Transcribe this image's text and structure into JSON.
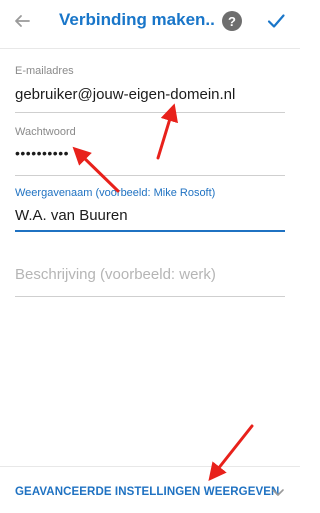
{
  "header": {
    "title": "Verbinding maken...",
    "help_symbol": "?",
    "back_icon": "arrow-left-icon",
    "confirm_icon": "checkmark-icon"
  },
  "form": {
    "email": {
      "label": "E-mailadres",
      "value": "gebruiker@jouw-eigen-domein.nl"
    },
    "password": {
      "label": "Wachtwoord",
      "value": "••••••••••"
    },
    "display_name": {
      "label": "Weergavenaam (voorbeeld: Mike Rosoft)",
      "value": "W.A. van Buuren"
    },
    "description": {
      "placeholder": "Beschrijving (voorbeeld: werk)"
    }
  },
  "footer": {
    "advanced_label": "GEAVANCEERDE INSTELLINGEN WEERGEVEN",
    "expand_icon": "chevron-down-icon"
  },
  "colors": {
    "accent": "#1f72c2",
    "title": "#1976c9",
    "annotation_arrow": "#e8211b",
    "help_bg": "#6e6e6e"
  }
}
